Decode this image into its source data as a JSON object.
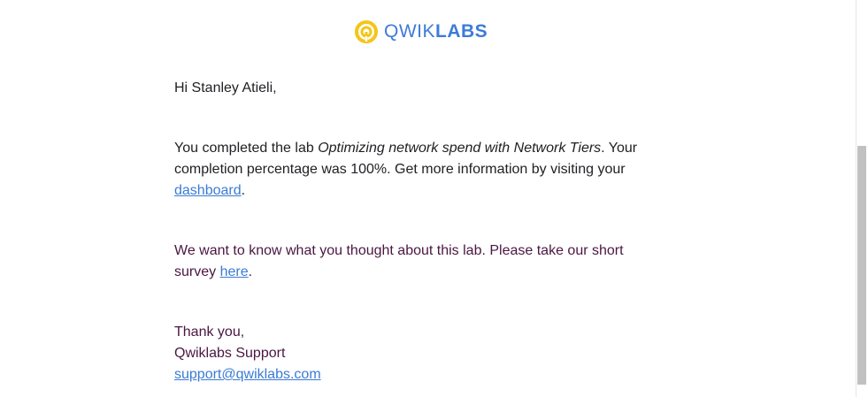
{
  "brand": {
    "logo_light": "QWIK",
    "logo_bold": "LABS",
    "logo_icon": "qwiklabs-ring-icon",
    "colors": {
      "logo_blue": "#3d7bd9",
      "logo_yellow": "#f5c518",
      "link": "#3a7bd5",
      "plum_text": "#4a1642"
    }
  },
  "email": {
    "greeting": "Hi Stanley Atieli,",
    "completion": {
      "prefix": "You completed the lab ",
      "lab_name": "Optimizing network spend with Network Tiers",
      "middle": ". Your completion percentage was 100%. Get more information by visiting your ",
      "link_text": "dashboard",
      "suffix": "."
    },
    "survey": {
      "prefix": "We want to know what you thought about this lab. Please take our short survey ",
      "link_text": "here",
      "suffix": "."
    },
    "signoff": {
      "thanks": "Thank you,",
      "team": "Qwiklabs Support",
      "email_link": "support@qwiklabs.com"
    }
  }
}
